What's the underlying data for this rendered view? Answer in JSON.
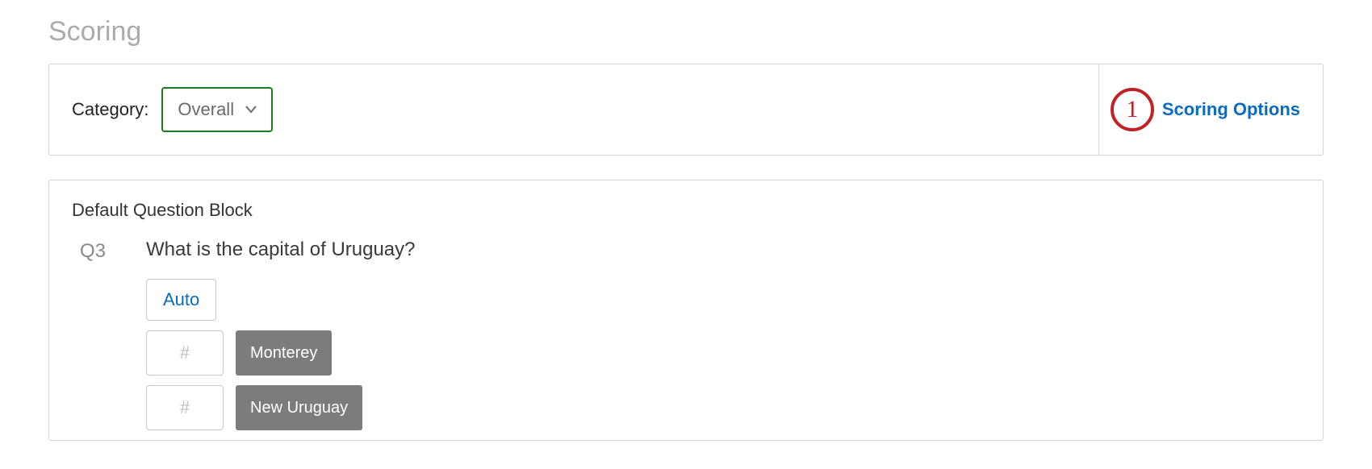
{
  "page_title": "Scoring",
  "category": {
    "label": "Category:",
    "selected": "Overall"
  },
  "callout_number": "1",
  "scoring_options_label": "Scoring Options",
  "block": {
    "title": "Default Question Block",
    "question": {
      "id": "Q3",
      "text": "What is the capital of Uruguay?",
      "auto_label": "Auto",
      "score_placeholder": "#",
      "choices": [
        {
          "label": "Monterey"
        },
        {
          "label": "New Uruguay"
        }
      ]
    }
  }
}
